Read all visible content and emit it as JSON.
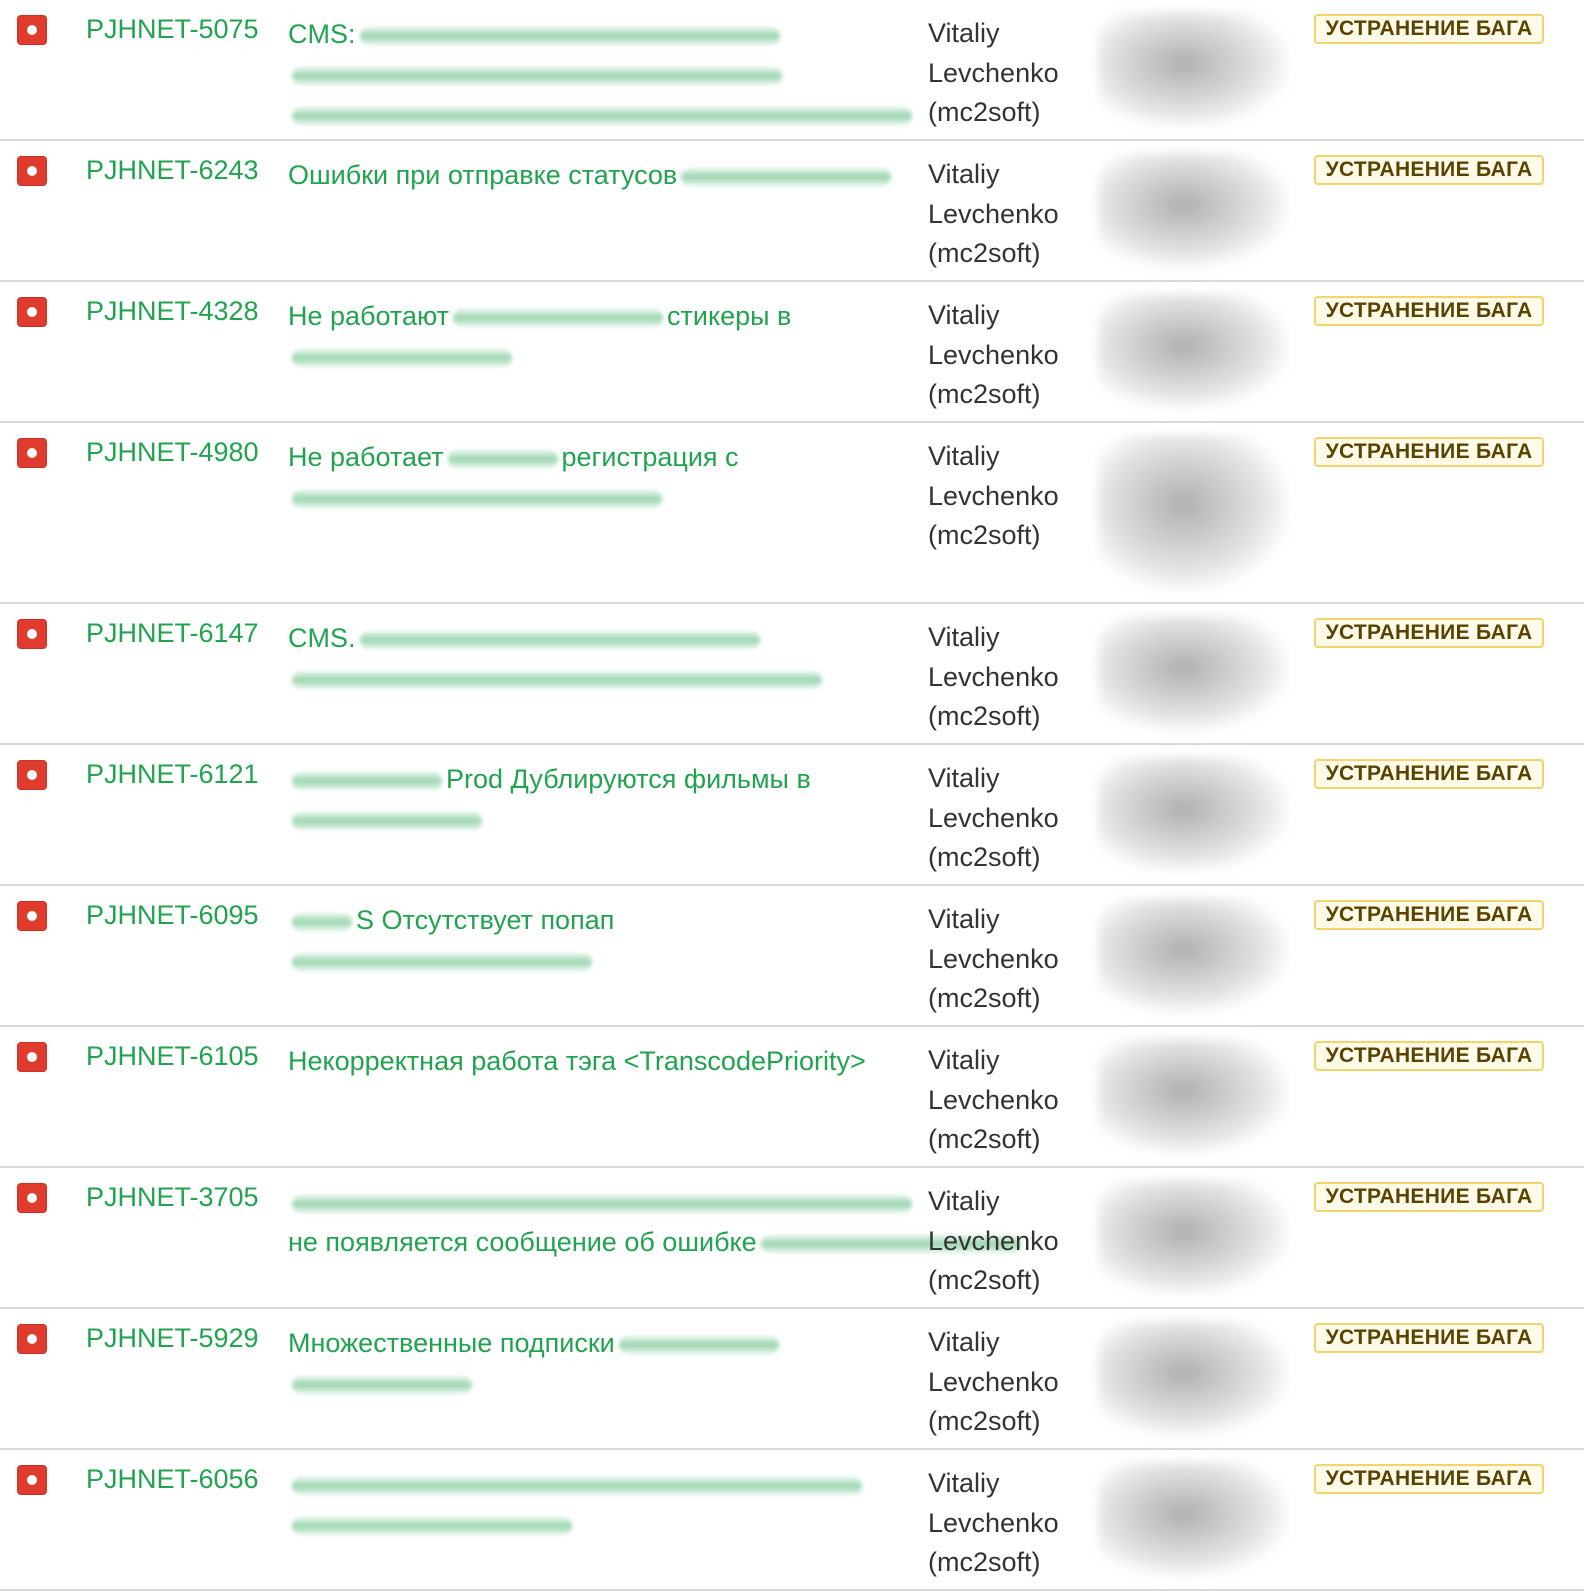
{
  "status_label": "УСТРАНЕНИЕ БАГА",
  "issue_type_icon": "bug-icon",
  "colors": {
    "link": "#21a350",
    "bug_icon": "#e03c2d",
    "badge_border": "#f2d46a",
    "badge_text": "#594300"
  },
  "issues": [
    {
      "key": "PJHNET-5075",
      "summary_lines": [
        [
          "CMS:"
        ],
        [],
        []
      ],
      "assignee": [
        "Vitaliy",
        "Levchenko",
        "(mc2soft)"
      ]
    },
    {
      "key": "PJHNET-6243",
      "summary_lines": [
        [
          "Ошибки при отправке статусов"
        ]
      ],
      "assignee": [
        "Vitaliy",
        "Levchenko",
        "(mc2soft)"
      ]
    },
    {
      "key": "PJHNET-4328",
      "summary_lines": [
        [
          "Не работают",
          "стикеры в"
        ],
        []
      ],
      "assignee": [
        "Vitaliy",
        "Levchenko",
        "(mc2soft)"
      ]
    },
    {
      "key": "PJHNET-4980",
      "summary_lines": [
        [
          "Не работает",
          "регистрация с"
        ],
        []
      ],
      "assignee": [
        "Vitaliy",
        "Levchenko",
        "(mc2soft)"
      ]
    },
    {
      "key": "PJHNET-6147",
      "summary_lines": [
        [
          "CMS."
        ],
        []
      ],
      "assignee": [
        "Vitaliy",
        "Levchenko",
        "(mc2soft)"
      ]
    },
    {
      "key": "PJHNET-6121",
      "summary_lines": [
        [
          "",
          "Prod Дублируются фильмы в"
        ],
        []
      ],
      "assignee": [
        "Vitaliy",
        "Levchenko",
        "(mc2soft)"
      ]
    },
    {
      "key": "PJHNET-6095",
      "summary_lines": [
        [
          "",
          "S Отсутствует попап"
        ],
        []
      ],
      "assignee": [
        "Vitaliy",
        "Levchenko",
        "(mc2soft)"
      ]
    },
    {
      "key": "PJHNET-6105",
      "summary_lines": [
        [
          "Некорректная работа тэга <TranscodePriority>"
        ]
      ],
      "assignee": [
        "Vitaliy",
        "Levchenko",
        "(mc2soft)"
      ]
    },
    {
      "key": "PJHNET-3705",
      "summary_lines": [
        [],
        [
          "не появляется сообщение об ошибке"
        ],
        []
      ],
      "assignee": [
        "Vitaliy",
        "Levchenko",
        "(mc2soft)"
      ]
    },
    {
      "key": "PJHNET-5929",
      "summary_lines": [
        [
          "Множественные подписки"
        ],
        []
      ],
      "assignee": [
        "Vitaliy",
        "Levchenko",
        "(mc2soft)"
      ]
    },
    {
      "key": "PJHNET-6056",
      "summary_lines": [
        [],
        []
      ],
      "assignee": [
        "Vitaliy",
        "Levchenko",
        "(mc2soft)"
      ]
    }
  ]
}
